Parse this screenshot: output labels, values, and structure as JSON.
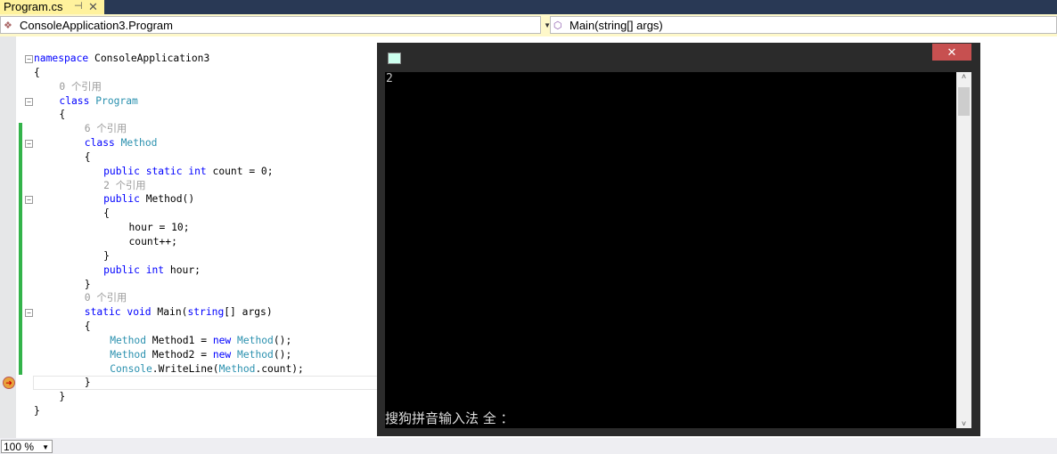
{
  "tab": {
    "title": "Program.cs",
    "pin": "⊣",
    "close": "✕"
  },
  "nav": {
    "type_combo": "ConsoleApplication3.Program",
    "member_combo": "Main(string[] args)"
  },
  "code": [
    {
      "ind": 0,
      "fold": "−",
      "tok": [
        [
          "kw",
          "namespace"
        ],
        [
          "pl",
          " ConsoleApplication3"
        ]
      ]
    },
    {
      "ind": 0,
      "tok": [
        [
          "pl",
          "{"
        ]
      ]
    },
    {
      "ind": 4,
      "tok": [
        [
          "ln",
          "0 个引用"
        ]
      ]
    },
    {
      "ind": 4,
      "fold": "−",
      "tok": [
        [
          "kw",
          "class"
        ],
        [
          "pl",
          " "
        ],
        [
          "ty",
          "Program"
        ]
      ]
    },
    {
      "ind": 4,
      "tok": [
        [
          "pl",
          "{"
        ]
      ]
    },
    {
      "ind": 8,
      "tok": [
        [
          "ln",
          "6 个引用"
        ]
      ]
    },
    {
      "ind": 8,
      "fold": "−",
      "tok": [
        [
          "kw",
          "class"
        ],
        [
          "pl",
          " "
        ],
        [
          "ty",
          "Method"
        ]
      ]
    },
    {
      "ind": 8,
      "tok": [
        [
          "pl",
          "{"
        ]
      ]
    },
    {
      "ind": 11,
      "tok": [
        [
          "kw",
          "public static int"
        ],
        [
          "pl",
          " count = 0;"
        ]
      ]
    },
    {
      "ind": 11,
      "tok": [
        [
          "ln",
          "2 个引用"
        ]
      ]
    },
    {
      "ind": 11,
      "fold": "−",
      "tok": [
        [
          "kw",
          "public"
        ],
        [
          "pl",
          " Method()"
        ]
      ]
    },
    {
      "ind": 11,
      "tok": [
        [
          "pl",
          "{"
        ]
      ]
    },
    {
      "ind": 15,
      "tok": [
        [
          "pl",
          "hour = 10;"
        ]
      ]
    },
    {
      "ind": 15,
      "tok": [
        [
          "pl",
          "count++;"
        ]
      ]
    },
    {
      "ind": 11,
      "tok": [
        [
          "pl",
          "}"
        ]
      ]
    },
    {
      "ind": 11,
      "tok": [
        [
          "kw",
          "public int"
        ],
        [
          "pl",
          " hour;"
        ]
      ]
    },
    {
      "ind": 8,
      "tok": [
        [
          "pl",
          "}"
        ]
      ]
    },
    {
      "ind": 8,
      "tok": [
        [
          "ln",
          "0 个引用"
        ]
      ]
    },
    {
      "ind": 8,
      "fold": "−",
      "tok": [
        [
          "kw",
          "static void"
        ],
        [
          "pl",
          " Main("
        ],
        [
          "kw",
          "string"
        ],
        [
          "pl",
          "[] args)"
        ]
      ]
    },
    {
      "ind": 8,
      "tok": [
        [
          "pl",
          "{"
        ]
      ]
    },
    {
      "ind": 12,
      "tok": [
        [
          "ty",
          "Method"
        ],
        [
          "pl",
          " Method1 = "
        ],
        [
          "kw",
          "new"
        ],
        [
          "pl",
          " "
        ],
        [
          "ty",
          "Method"
        ],
        [
          "pl",
          "();"
        ]
      ]
    },
    {
      "ind": 12,
      "tok": [
        [
          "ty",
          "Method"
        ],
        [
          "pl",
          " Method2 = "
        ],
        [
          "kw",
          "new"
        ],
        [
          "pl",
          " "
        ],
        [
          "ty",
          "Method"
        ],
        [
          "pl",
          "();"
        ]
      ]
    },
    {
      "ind": 12,
      "tok": [
        [
          "ty",
          "Console"
        ],
        [
          "pl",
          ".WriteLine("
        ],
        [
          "ty",
          "Method"
        ],
        [
          "pl",
          ".count);"
        ]
      ]
    },
    {
      "ind": 8,
      "tok": [
        [
          "pl",
          "}"
        ]
      ]
    },
    {
      "ind": 4,
      "tok": [
        [
          "pl",
          "}"
        ]
      ]
    },
    {
      "ind": 0,
      "tok": [
        [
          "pl",
          "}"
        ]
      ]
    }
  ],
  "console": {
    "close": "✕",
    "output": "2",
    "ime": "搜狗拼音输入法 全 ："
  },
  "status": {
    "zoom": "100 %"
  },
  "colors": {
    "tab_active": "#fff29d",
    "chrome": "#293955",
    "keyword": "#0000ff",
    "type": "#2b91af",
    "close": "#c75050"
  }
}
